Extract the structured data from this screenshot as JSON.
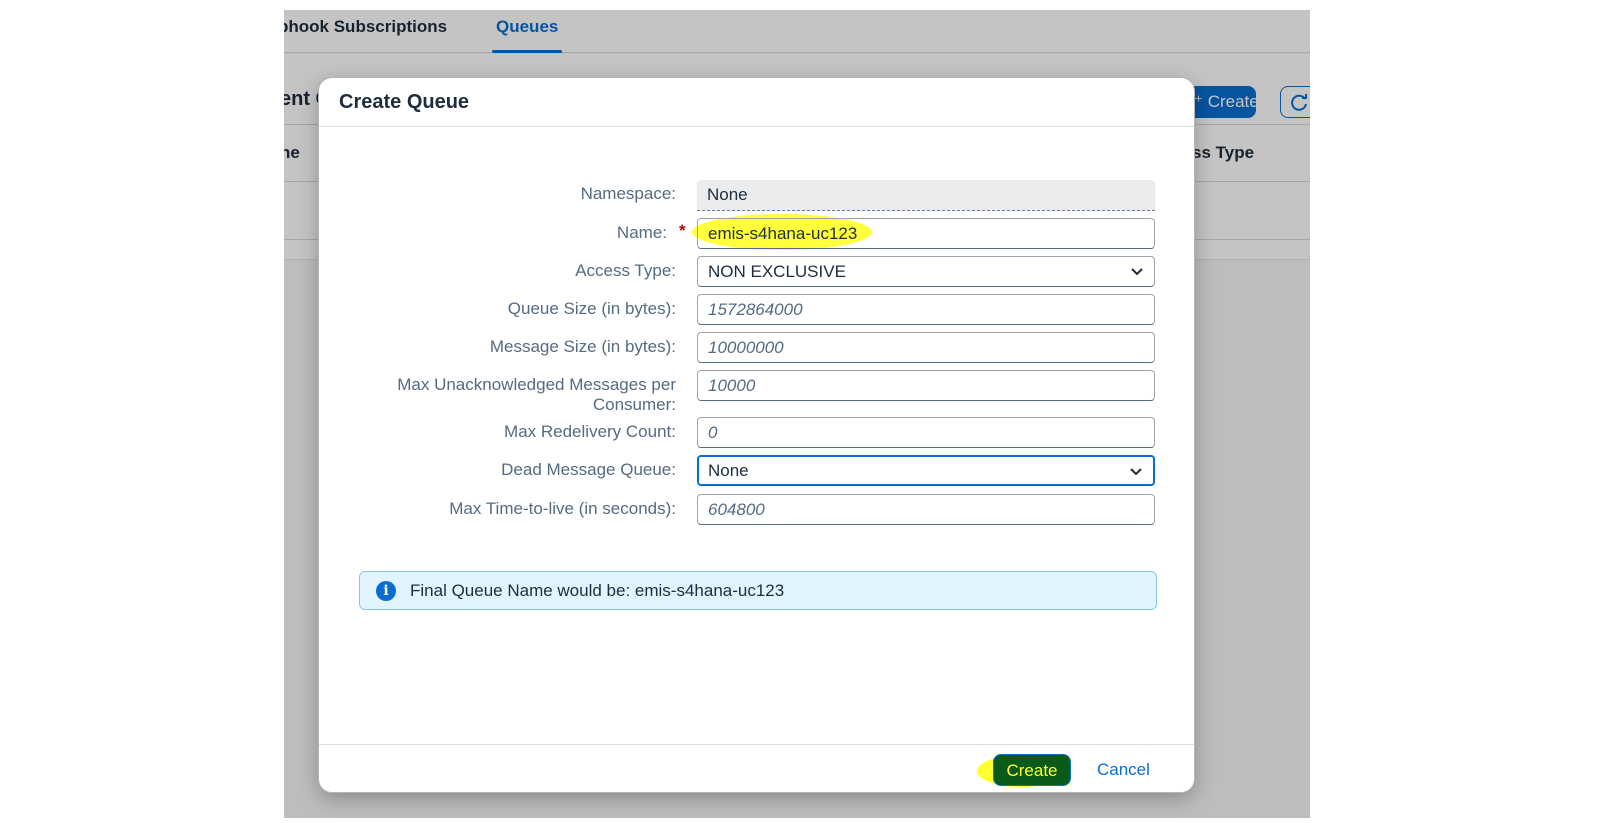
{
  "background": {
    "tabs": [
      {
        "label": "bhook Subscriptions"
      },
      {
        "label": "Queues"
      }
    ],
    "toolbar_title": "ent C",
    "create_label": "Create",
    "column_left": "ne",
    "column_right": "ss Type"
  },
  "dialog": {
    "title": "Create Queue",
    "fields": {
      "namespace": {
        "label": "Namespace:",
        "value": "None"
      },
      "name": {
        "label": "Name:",
        "required_mark": "*",
        "value": "emis-s4hana-uc123"
      },
      "access_type": {
        "label": "Access Type:",
        "value": "NON EXCLUSIVE"
      },
      "queue_size": {
        "label": "Queue Size (in bytes):",
        "placeholder": "1572864000"
      },
      "message_size": {
        "label": "Message Size (in bytes):",
        "placeholder": "10000000"
      },
      "max_unack": {
        "label": "Max Unacknowledged Messages per Consumer:",
        "placeholder": "10000"
      },
      "max_redelivery": {
        "label": "Max Redelivery Count:",
        "placeholder": "0"
      },
      "dead_message_queue": {
        "label": "Dead Message Queue:",
        "value": "None"
      },
      "max_ttl": {
        "label": "Max Time-to-live (in seconds):",
        "placeholder": "604800"
      }
    },
    "info": {
      "icon": "info-icon",
      "text": "Final Queue Name would be: emis-s4hana-uc123"
    },
    "footer": {
      "create_label": "Create",
      "cancel_label": "Cancel"
    }
  },
  "colors": {
    "accent": "#0a6ed1",
    "highlight": "#ffff30",
    "create_button_bg": "#0a5a1a"
  }
}
